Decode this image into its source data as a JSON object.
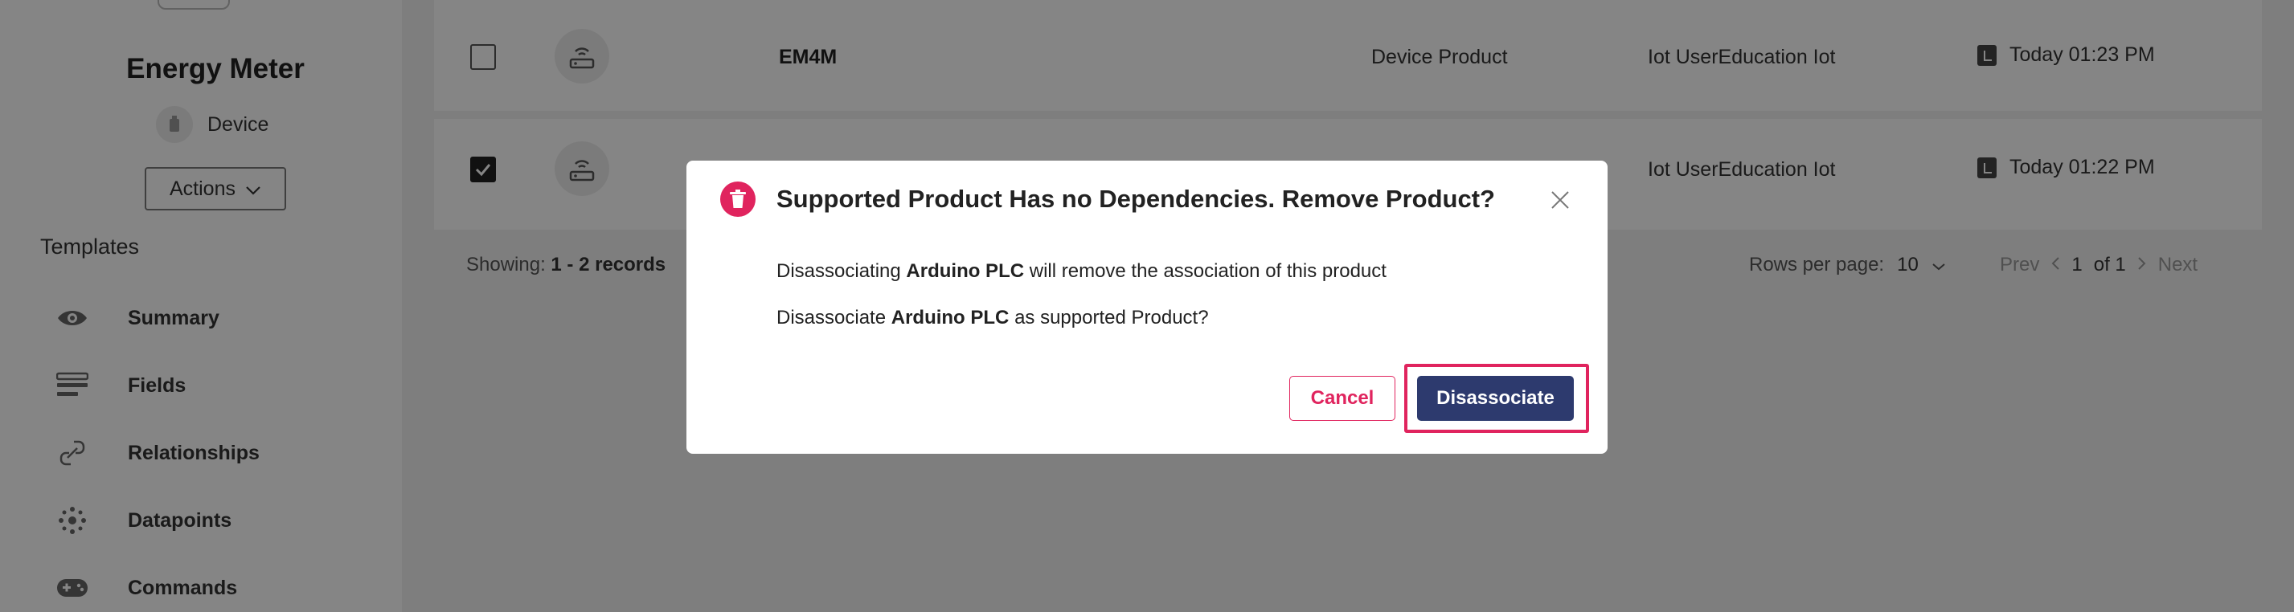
{
  "device": {
    "title": "Energy Meter",
    "type_label": "Device",
    "actions_label": "Actions"
  },
  "sidebar": {
    "heading": "Templates",
    "items": [
      {
        "label": "Summary",
        "icon": "eye-icon"
      },
      {
        "label": "Fields",
        "icon": "fields-icon"
      },
      {
        "label": "Relationships",
        "icon": "link-icon"
      },
      {
        "label": "Datapoints",
        "icon": "datapoints-icon"
      },
      {
        "label": "Commands",
        "icon": "gamepad-icon"
      }
    ]
  },
  "table": {
    "rows": [
      {
        "checked": false,
        "name": "EM4M",
        "type": "Device Product",
        "user": "Iot UserEducation Iot",
        "time": "Today 01:23 PM"
      },
      {
        "checked": true,
        "name": "",
        "type": "",
        "user": "Iot UserEducation Iot",
        "time": "Today 01:22 PM"
      }
    ],
    "showing_prefix": "Showing:",
    "showing_range": "1 - 2 records",
    "rows_per_page_label": "Rows per page:",
    "rows_per_page_value": "10",
    "prev_label": "Prev",
    "page_current": "1",
    "page_of": "of 1",
    "next_label": "Next"
  },
  "modal": {
    "title": "Supported Product Has no Dependencies. Remove Product?",
    "msg1_pre": "Disassociating",
    "msg1_product": "Arduino PLC",
    "msg1_post": "will remove the association of this product",
    "msg2_pre": "Disassociate",
    "msg2_product": "Arduino PLC",
    "msg2_post": "as supported Product?",
    "cancel_label": "Cancel",
    "confirm_label": "Disassociate"
  },
  "colors": {
    "accent": "#e0245e",
    "primary": "#2d3a6e",
    "overlay": "rgba(0,0,0,0.48)"
  }
}
